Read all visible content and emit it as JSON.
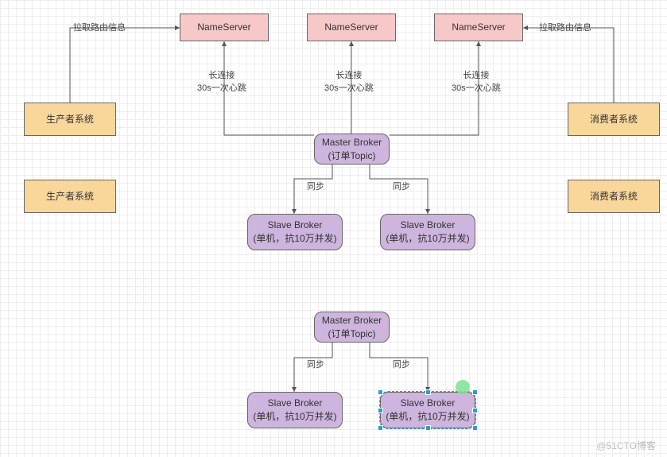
{
  "nodes": {
    "ns1": "NameServer",
    "ns2": "NameServer",
    "ns3": "NameServer",
    "prod1": "生产者系统",
    "prod2": "生产者系统",
    "cons1": "消费者系统",
    "cons2": "消费者系统",
    "master1": "Master Broker\n(订单Topic)",
    "master2": "Master Broker\n(订单Topic)",
    "slave1": "Slave Broker\n(单机，抗10万并发)",
    "slave2": "Slave Broker\n(单机，抗10万并发)",
    "slave3": "Slave Broker\n(单机，抗10万并发)",
    "slave4": "Slave Broker\n(单机，抗10万并发)"
  },
  "labels": {
    "route_left": "拉取路由信息",
    "route_right": "拉取路由信息",
    "hb1": "长连接\n30s一次心跳",
    "hb2": "长连接\n30s一次心跳",
    "hb3": "长连接\n30s一次心跳",
    "sync1": "同步",
    "sync2": "同步",
    "sync3": "同步",
    "sync4": "同步"
  },
  "watermark": "@51CTO博客",
  "colors": {
    "pink": "#f6c8c8",
    "orange": "#f9d79b",
    "purple": "#cdb5dd",
    "selection": "#2e9bd6",
    "seldot": "#7de48f"
  }
}
